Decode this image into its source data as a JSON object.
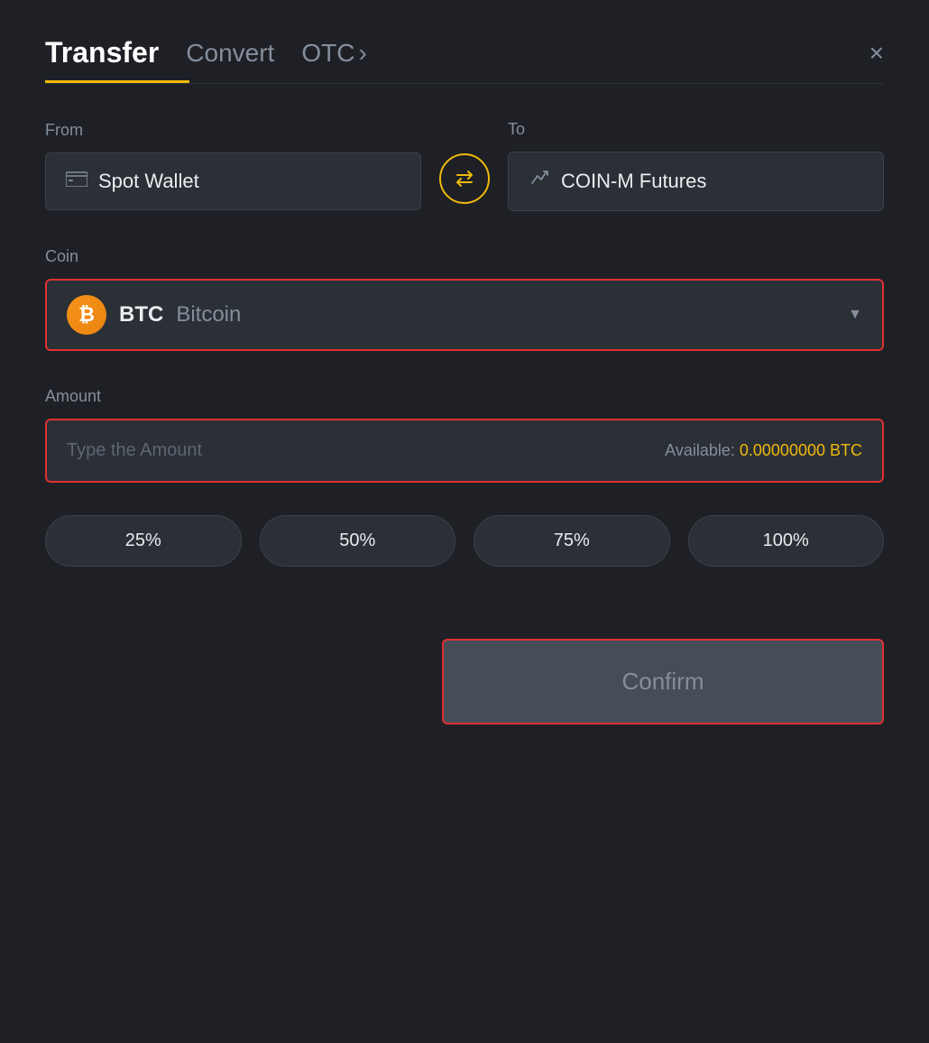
{
  "header": {
    "title": "Transfer",
    "tabs": [
      {
        "label": "Convert",
        "active": false
      },
      {
        "label": "OTC",
        "active": false,
        "has_arrow": true
      }
    ],
    "close_label": "×"
  },
  "from": {
    "label": "From",
    "wallet": "Spot Wallet",
    "icon": "💳"
  },
  "to": {
    "label": "To",
    "wallet": "COIN-M Futures",
    "icon": "↑"
  },
  "coin": {
    "label": "Coin",
    "symbol": "BTC",
    "name": "Bitcoin",
    "dropdown_arrow": "▼"
  },
  "amount": {
    "label": "Amount",
    "placeholder": "Type the Amount",
    "available_label": "Available:",
    "available_value": "0.00000000 BTC"
  },
  "percent_buttons": [
    "25%",
    "50%",
    "75%",
    "100%"
  ],
  "confirm": {
    "label": "Confirm"
  }
}
